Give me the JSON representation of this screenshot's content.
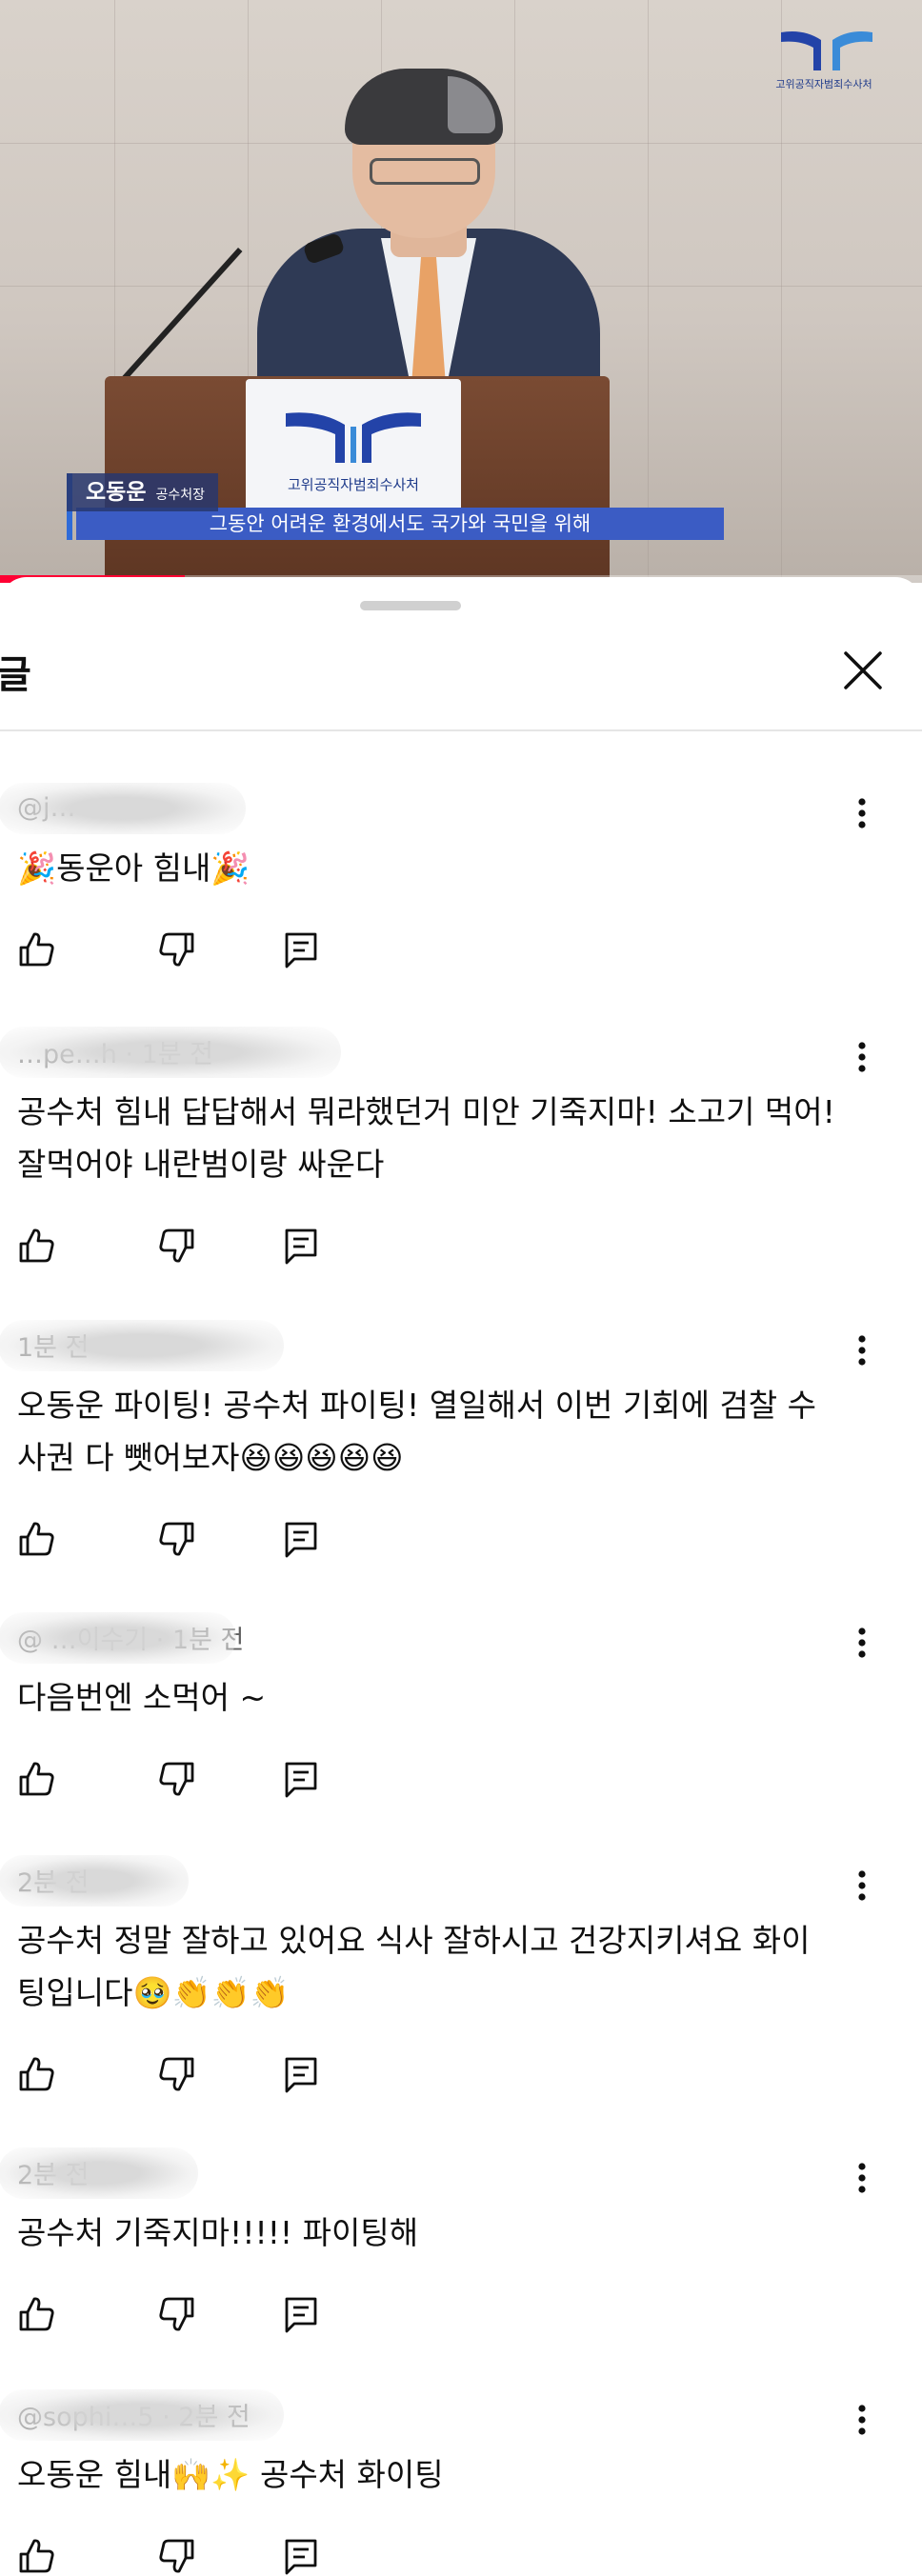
{
  "video": {
    "speaker_name": "오동운",
    "speaker_title": "공수처장",
    "caption": "그동안 어려운 환경에서도 국가와 국민을 위해",
    "podium_logo_text": "고위공직자범죄수사처",
    "corner_logo_text": "고위공직자범죄수사처",
    "progress_fraction": 0.2,
    "progress_color": "#ff0033"
  },
  "sheet": {
    "title": "글",
    "close_icon": "close-icon"
  },
  "comments": [
    {
      "meta": "@j…",
      "text": "🎉동운아 힘내🎉"
    },
    {
      "meta": "…pe…h · 1분 전",
      "text": "공수처 힘내 답답해서 뭐라했던거 미안 기죽지마! 소고기 먹어! 잘먹어야 내란범이랑 싸운다"
    },
    {
      "meta": "1분 전",
      "text": "오동운 파이팅! 공수처 파이팅! 열일해서 이번 기회에 검찰 수사권 다 뺏어보자😆😆😆😆😆"
    },
    {
      "meta": "@ …이수기 · 1분 전",
      "text": "다음번엔 소먹어 ~"
    },
    {
      "meta": "2분 전",
      "text": "공수처 정말 잘하고 있어요 식사 잘하시고 건강지키셔요 화이팅입니다🥹👏👏👏"
    },
    {
      "meta": "2분 전",
      "text": "공수처 기죽지마!!!!! 파이팅해"
    },
    {
      "meta": "@sophi…5 · 2분 전",
      "text": "오동운 힘내🙌✨ 공수처 화이팅"
    }
  ],
  "icons": {
    "like": "thumb-up-icon",
    "dislike": "thumb-down-icon",
    "reply": "reply-icon",
    "more": "more-vertical-icon"
  }
}
